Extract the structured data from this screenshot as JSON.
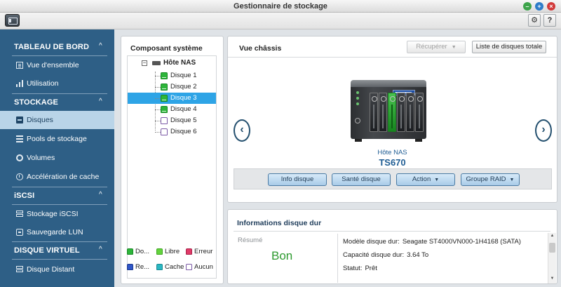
{
  "window": {
    "title": "Gestionnaire de stockage",
    "min": "–",
    "max": "+",
    "close": "×"
  },
  "toolbar": {
    "gear": "⚙",
    "help": "?"
  },
  "sidebar": {
    "sections": [
      {
        "title": "TABLEAU DE BORD",
        "items": [
          "Vue d'ensemble",
          "Utilisation"
        ]
      },
      {
        "title": "STOCKAGE",
        "items": [
          "Disques",
          "Pools de stockage",
          "Volumes",
          "Accélération de cache"
        ]
      },
      {
        "title": "iSCSI",
        "items": [
          "Stockage iSCSI",
          "Sauvegarde LUN"
        ]
      },
      {
        "title": "DISQUE VIRTUEL",
        "items": [
          "Disque Distant"
        ]
      }
    ],
    "active": "Disques",
    "chevron": "^"
  },
  "tree": {
    "title": "Composant système",
    "toggle": "−",
    "root": "Hôte NAS",
    "disks": [
      "Disque 1",
      "Disque 2",
      "Disque 3",
      "Disque 4",
      "Disque 5",
      "Disque 6"
    ],
    "selected": "Disque 3",
    "legend": [
      {
        "label": "Do...",
        "color": "#2db53a"
      },
      {
        "label": "Libre",
        "color": "#63d33e"
      },
      {
        "label": "Erreur",
        "color": "#e03a68"
      },
      {
        "label": "Re...",
        "color": "#2f56c8"
      },
      {
        "label": "Cache",
        "color": "#2ab7c2"
      },
      {
        "label": "Aucun",
        "color": "#ffffff"
      }
    ]
  },
  "chassis": {
    "title": "Vue châssis",
    "recover_label": "Récupérer",
    "list_label": "Liste de disques totale",
    "prev": "‹",
    "next": "›",
    "host_label": "Hôte NAS",
    "model": "TS670",
    "actions": [
      "Info disque",
      "Santé disque",
      "Action",
      "Groupe RAID"
    ]
  },
  "info": {
    "title": "Informations disque dur",
    "resume_label": "Résumé",
    "resume_value": "Bon",
    "rows": [
      {
        "key": "Modèle disque dur:",
        "value": "Seagate ST4000VN000-1H4168 (SATA)"
      },
      {
        "key": "Capacité disque dur:",
        "value": "3.64 To"
      },
      {
        "key": "Statut:",
        "value": "Prêt"
      }
    ]
  },
  "colors": {
    "sidebar": "#2e5f86",
    "accent": "#2ea4e6",
    "good": "#2d9a2f"
  }
}
